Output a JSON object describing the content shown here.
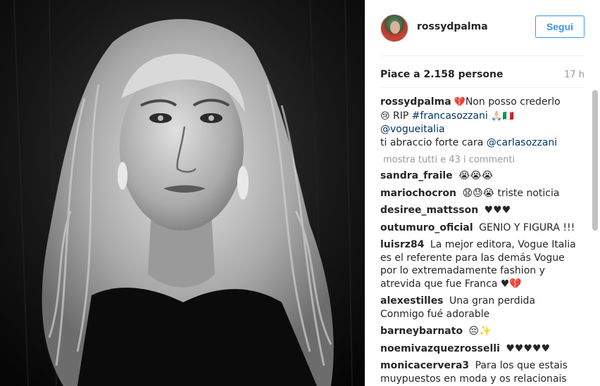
{
  "post": {
    "username": "rossydpalma",
    "follow_label": "Segui",
    "likes": "Piace a 2.158 persone",
    "time": "17 h"
  },
  "caption": {
    "username": "rossydpalma",
    "e1": "💔",
    "t1": "Non posso crederlo",
    "e2": "😢",
    "t2": "RIP",
    "tag1": "#francasozzani",
    "e3": "🙏🏻🇮🇹",
    "tag2": "@vogueitalia",
    "t3": "ti abraccio forte cara",
    "tag3": "@carlasozzani"
  },
  "show_all": "mostra tutti e 43 i commenti",
  "comments": [
    {
      "user": "sandra_fraile",
      "text": "😭😭😭"
    },
    {
      "user": "mariochocron",
      "text": "😧😓😭 triste noticia"
    },
    {
      "user": "desiree_mattsson",
      "text": "♥♥♥"
    },
    {
      "user": "outumuro_oficial",
      "text": "GENIO Y FIGURA !!!"
    },
    {
      "user": "luisrz84",
      "text": "La mejor editora, Vogue Italia es el referente para las demás Vogue por lo extremadamente fashion y atrevida que fue Franca ♥💔"
    },
    {
      "user": "alexestilles",
      "text": "Una gran perdida Conmigo fué adorable"
    },
    {
      "user": "barneybarnato",
      "text": "😔✨"
    },
    {
      "user": "noemivazquezrosselli",
      "text": "♥♥♥♥♥"
    },
    {
      "user": "monicacervera3",
      "text": "Para los que estais muypuestos en moda y os relacionais"
    }
  ],
  "colors": {
    "accent": "#3897f0",
    "hashtag": "#003569",
    "muted": "#999999"
  },
  "icons": {
    "avatar": "profile-photo"
  }
}
